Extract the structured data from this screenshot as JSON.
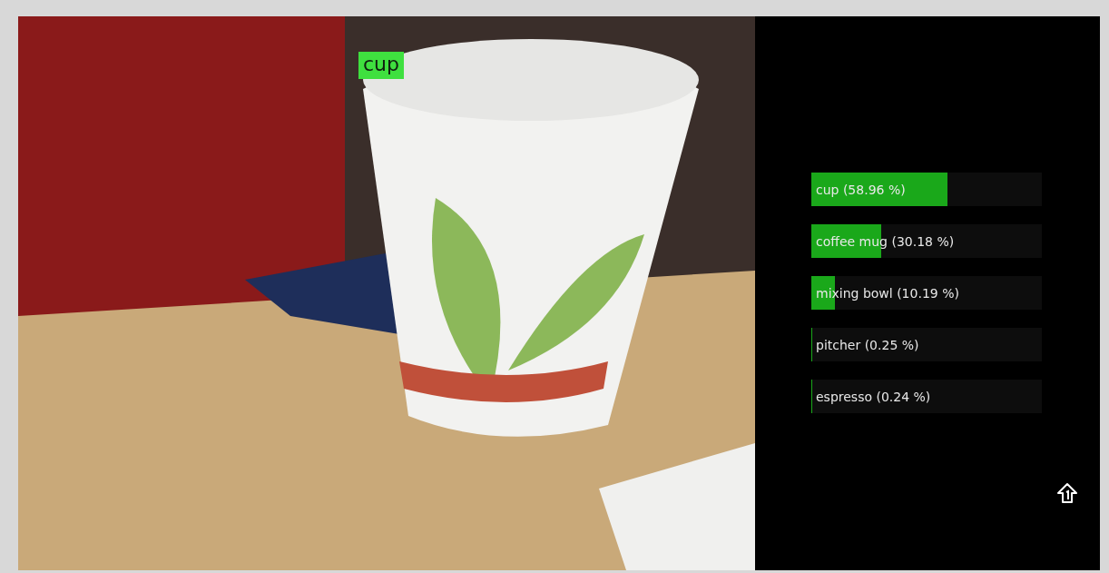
{
  "camera_view": {
    "detection_label": "cup"
  },
  "predictions": [
    {
      "label": "cup (58.96 %)",
      "level": 0.5896
    },
    {
      "label": "coffee mug (30.18 %)",
      "level": 0.3018
    },
    {
      "label": "mixing bowl (10.19 %)",
      "level": 0.1019
    },
    {
      "label": "pitcher (0.25 %)",
      "level": 0.0025
    },
    {
      "label": "espresso (0.24 %)",
      "level": 0.0024
    }
  ]
}
